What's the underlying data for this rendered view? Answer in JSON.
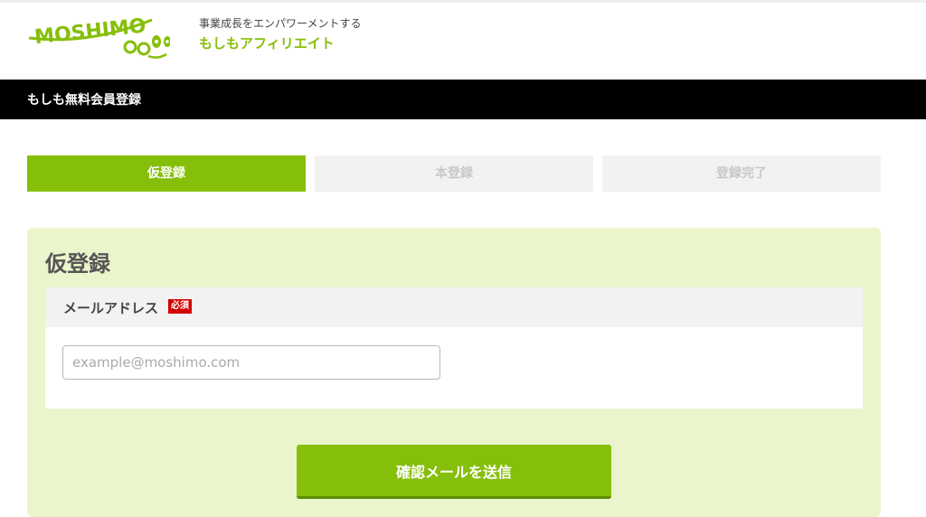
{
  "header": {
    "logo_text": "MOSHIMO",
    "tagline": "事業成長をエンパワーメントする",
    "brand_name": "もしもアフィリエイト"
  },
  "titlebar": {
    "title": "もしも無料会員登録"
  },
  "steps": [
    {
      "label": "仮登録",
      "state": "active"
    },
    {
      "label": "本登録",
      "state": "inactive"
    },
    {
      "label": "登録完了",
      "state": "inactive"
    }
  ],
  "form": {
    "title": "仮登録",
    "email_label": "メールアドレス",
    "required_badge": "必須",
    "email_value": "",
    "email_placeholder": "example@moshimo.com",
    "submit_label": "確認メールを送信"
  },
  "colors": {
    "accent": "#86bf0a",
    "panel_bg": "#eaf5cc",
    "required": "#d40000"
  }
}
